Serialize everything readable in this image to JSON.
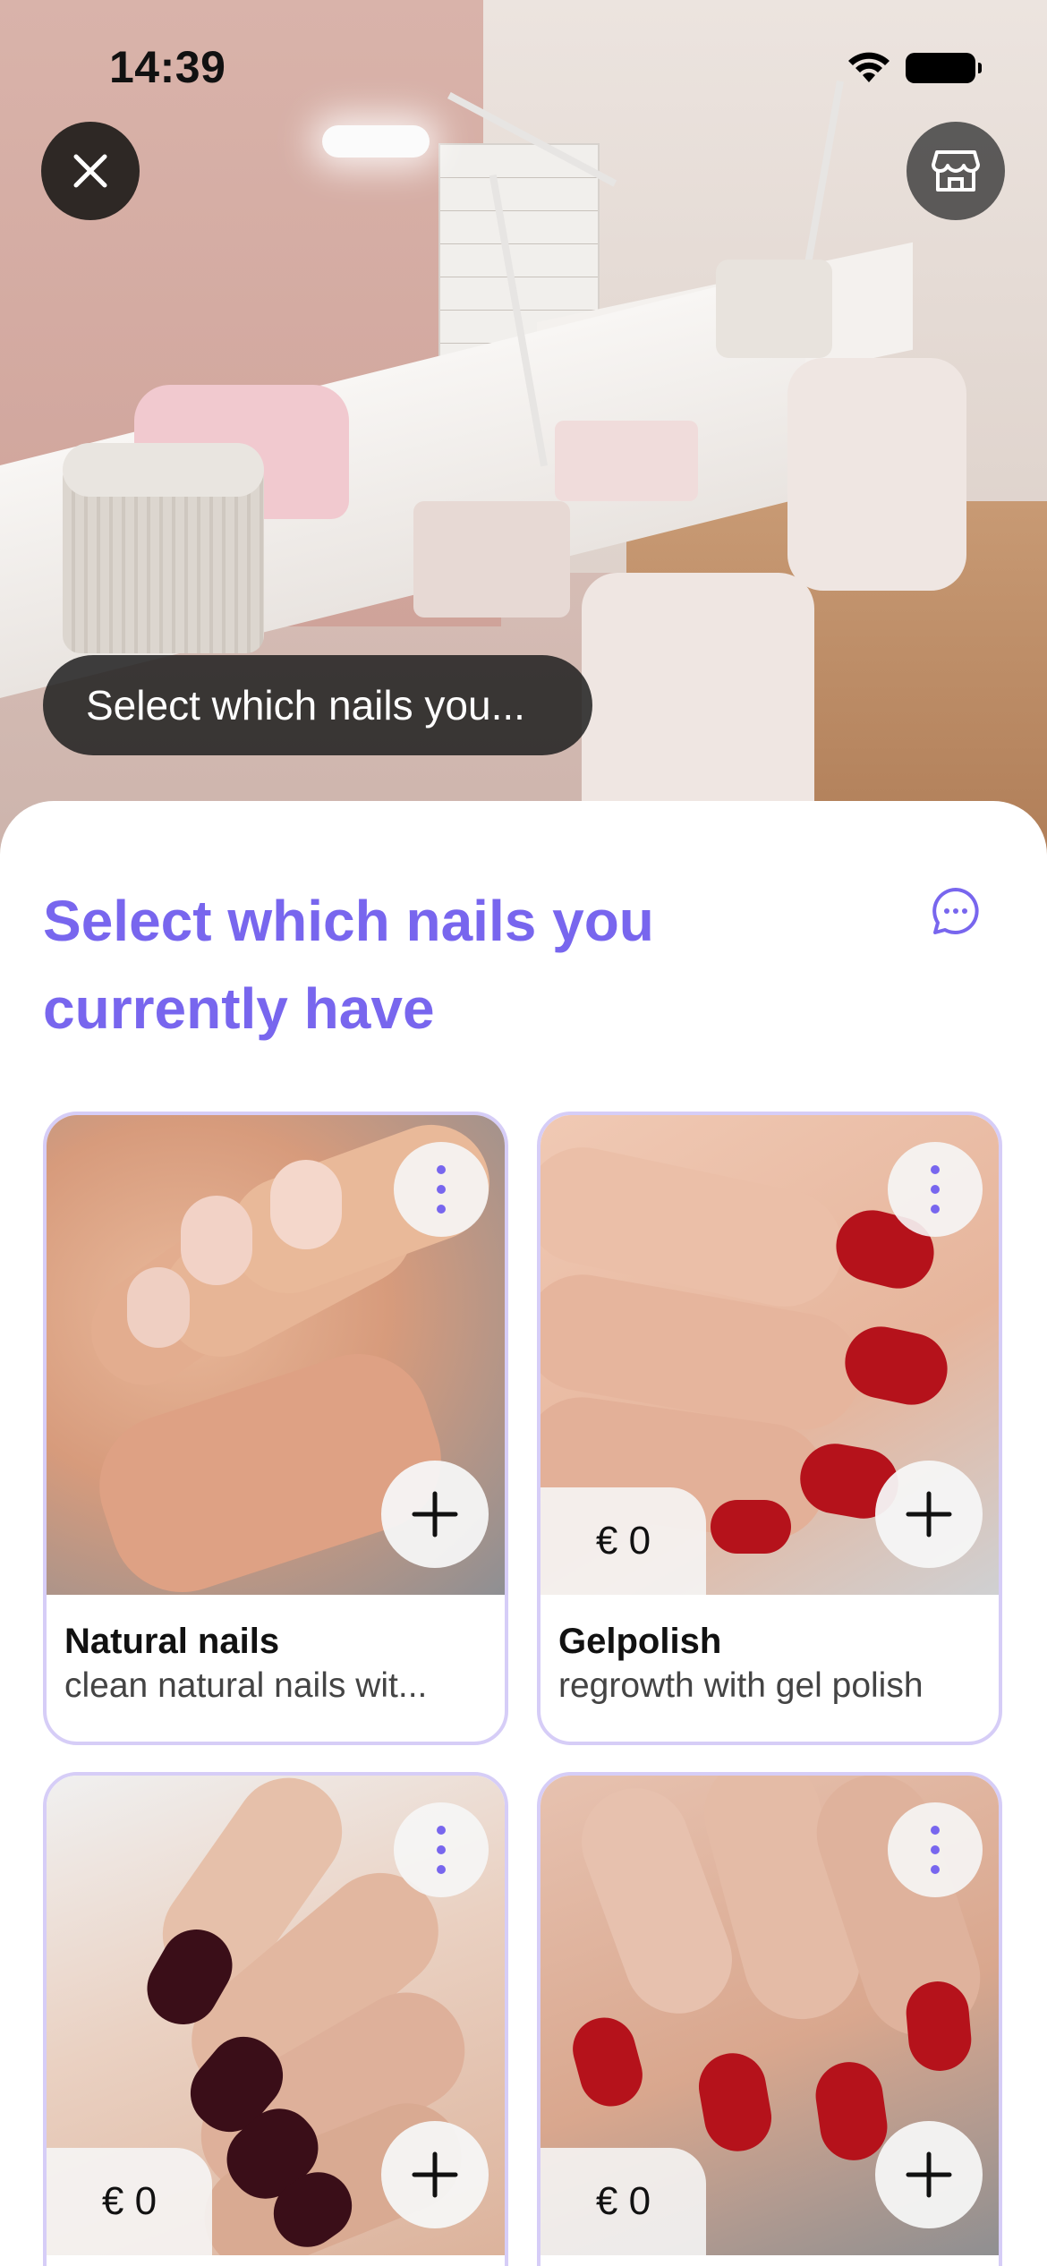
{
  "status_bar": {
    "time": "14:39"
  },
  "hero": {
    "overlay_text": "Select which nails you..."
  },
  "sheet": {
    "title": "Select which nails you currently have"
  },
  "cards": [
    {
      "title": "Natural nails",
      "subtitle": "clean natural nails wit...",
      "price": null
    },
    {
      "title": "Gelpolish",
      "subtitle": "regrowth with gel polish",
      "price": "€ 0"
    },
    {
      "title": "",
      "subtitle": "",
      "price": "€ 0"
    },
    {
      "title": "",
      "subtitle": "",
      "price": "€ 0"
    }
  ],
  "colors": {
    "accent": "#7866ee",
    "card_border": "#d6cdf7",
    "nail_red": "#b5121b",
    "nail_dark": "#3a0e18"
  },
  "icons": {
    "close": "close-icon",
    "store": "store-icon",
    "chat": "chat-bubble-icon",
    "more": "more-vertical-icon",
    "add": "plus-icon"
  }
}
